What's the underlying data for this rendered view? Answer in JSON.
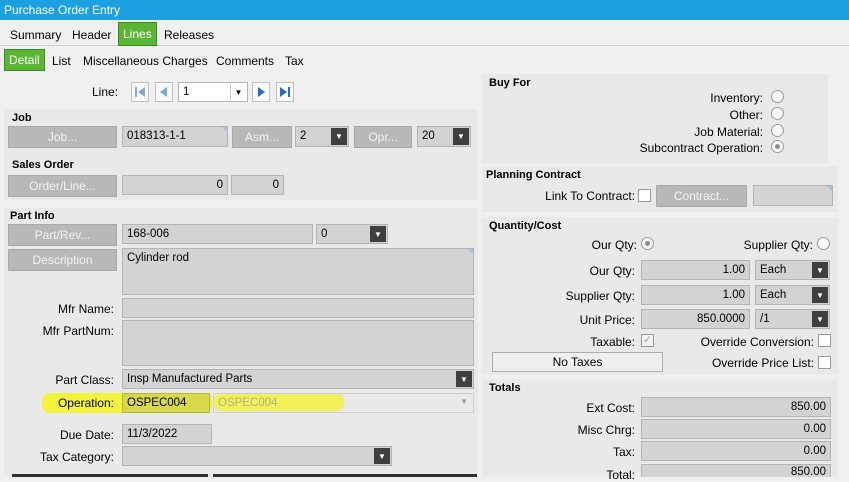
{
  "window": {
    "title": "Purchase Order Entry"
  },
  "main_tabs": [
    "Summary",
    "Header",
    "Lines",
    "Releases"
  ],
  "sub_tabs": [
    "Detail",
    "List",
    "Miscellaneous Charges",
    "Comments",
    "Tax"
  ],
  "line": {
    "label": "Line:",
    "value": "1"
  },
  "job": {
    "header": "Job",
    "job_button": "Job...",
    "job_value": "018313-1-1",
    "asm_button": "Asm...",
    "asm_value": "2",
    "opr_button": "Opr...",
    "opr_value": "20"
  },
  "sales_order": {
    "header": "Sales Order",
    "button": "Order/Line...",
    "order_value": "0",
    "line_value": "0"
  },
  "part_info": {
    "header": "Part Info",
    "part_button": "Part/Rev...",
    "part_value": "168-006",
    "rev_value": "0",
    "description_button": "Description",
    "description_value": "Cylinder rod",
    "mfr_name_label": "Mfr Name:",
    "mfr_partnum_label": "Mfr PartNum:",
    "part_class_label": "Part Class:",
    "part_class_value": "Insp Manufactured Parts",
    "operation_label": "Operation:",
    "operation_value": "OSPEC004",
    "operation_desc": "OSPEC004",
    "due_date_label": "Due Date:",
    "due_date_value": "11/3/2022",
    "tax_category_label": "Tax Category:"
  },
  "buy_for": {
    "header": "Buy For",
    "options": [
      "Inventory:",
      "Other:",
      "Job Material:",
      "Subcontract Operation:"
    ],
    "selected_index": 3
  },
  "planning_contract": {
    "header": "Planning Contract",
    "link_label": "Link To Contract:",
    "contract_button": "Contract..."
  },
  "quantity_cost": {
    "header": "Quantity/Cost",
    "our_qty_radio_label": "Our Qty:",
    "supplier_qty_radio_label": "Supplier Qty:",
    "our_qty_label": "Our Qty:",
    "our_qty_value": "1.00",
    "our_qty_uom": "Each",
    "supplier_qty_label": "Supplier Qty:",
    "supplier_qty_value": "1.00",
    "supplier_qty_uom": "Each",
    "unit_price_label": "Unit Price:",
    "unit_price_value": "850.0000",
    "unit_price_per": "/1",
    "taxable_label": "Taxable:",
    "override_conversion_label": "Override Conversion:",
    "no_taxes_button": "No Taxes",
    "override_price_list_label": "Override Price List:"
  },
  "totals": {
    "header": "Totals",
    "ext_cost_label": "Ext Cost:",
    "ext_cost_value": "850.00",
    "misc_chrg_label": "Misc Chrg:",
    "misc_chrg_value": "0.00",
    "tax_label": "Tax:",
    "tax_value": "0.00",
    "total_label": "Total:",
    "total_value": "850.00"
  },
  "colors": {
    "title_bar": "#1ba1e2",
    "active_tab": "#5bb534",
    "highlight": "#f4f41e"
  }
}
